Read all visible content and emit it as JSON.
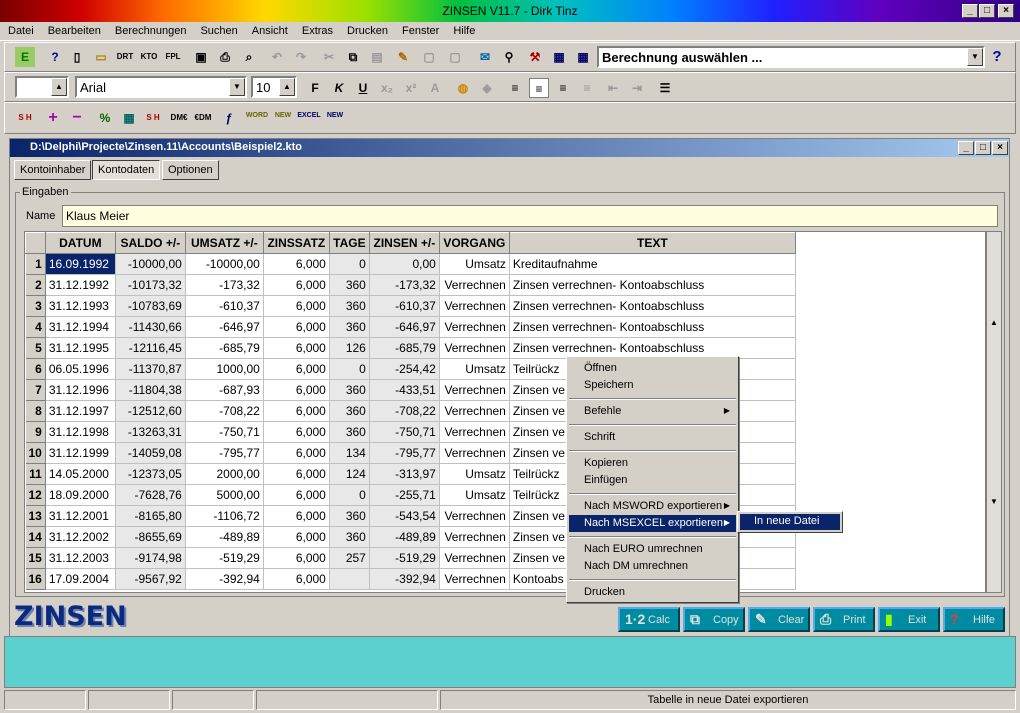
{
  "app": {
    "title": "ZINSEN V11.7 - Dirk Tinz"
  },
  "menu": [
    "Datei",
    "Bearbeiten",
    "Berechnungen",
    "Suchen",
    "Ansicht",
    "Extras",
    "Drucken",
    "Fenster",
    "Hilfe"
  ],
  "toolbar": {
    "calc_select": "Berechnung auswählen ...",
    "font_name": "Arial",
    "font_size": "10",
    "bold": "F",
    "italic": "K",
    "underline": "U",
    "help": "?"
  },
  "document": {
    "title": "D:\\Delphi\\Projecte\\Zinsen.11\\Accounts\\Beispiel2.kto",
    "tabs": [
      "Kontoinhaber",
      "Kontodaten",
      "Optionen"
    ],
    "group_label": "Eingaben",
    "name_label": "Name",
    "name_value": "Klaus Meier"
  },
  "table": {
    "headers": [
      "DATUM",
      "SALDO +/-",
      "UMSATZ +/-",
      "ZINSSATZ",
      "TAGE",
      "ZINSEN +/-",
      "VORGANG",
      "TEXT"
    ],
    "rows": [
      [
        "1",
        "16.09.1992",
        "-10000,00",
        "-10000,00",
        "6,000",
        "0",
        "0,00",
        "Umsatz",
        "Kreditaufnahme"
      ],
      [
        "2",
        "31.12.1992",
        "-10173,32",
        "-173,32",
        "6,000",
        "360",
        "-173,32",
        "Verrechnen",
        "Zinsen verrechnen- Kontoabschluss"
      ],
      [
        "3",
        "31.12.1993",
        "-10783,69",
        "-610,37",
        "6,000",
        "360",
        "-610,37",
        "Verrechnen",
        "Zinsen verrechnen- Kontoabschluss"
      ],
      [
        "4",
        "31.12.1994",
        "-11430,66",
        "-646,97",
        "6,000",
        "360",
        "-646,97",
        "Verrechnen",
        "Zinsen verrechnen- Kontoabschluss"
      ],
      [
        "5",
        "31.12.1995",
        "-12116,45",
        "-685,79",
        "6,000",
        "126",
        "-685,79",
        "Verrechnen",
        "Zinsen verrechnen- Kontoabschluss"
      ],
      [
        "6",
        "06.05.1996",
        "-11370,87",
        "1000,00",
        "6,000",
        "0",
        "-254,42",
        "Umsatz",
        "Teilrückz"
      ],
      [
        "7",
        "31.12.1996",
        "-11804,38",
        "-687,93",
        "6,000",
        "360",
        "-433,51",
        "Verrechnen",
        "Zinsen ve"
      ],
      [
        "8",
        "31.12.1997",
        "-12512,60",
        "-708,22",
        "6,000",
        "360",
        "-708,22",
        "Verrechnen",
        "Zinsen ve"
      ],
      [
        "9",
        "31.12.1998",
        "-13263,31",
        "-750,71",
        "6,000",
        "360",
        "-750,71",
        "Verrechnen",
        "Zinsen ve"
      ],
      [
        "10",
        "31.12.1999",
        "-14059,08",
        "-795,77",
        "6,000",
        "134",
        "-795,77",
        "Verrechnen",
        "Zinsen ve"
      ],
      [
        "11",
        "14.05.2000",
        "-12373,05",
        "2000,00",
        "6,000",
        "124",
        "-313,97",
        "Umsatz",
        "Teilrückz"
      ],
      [
        "12",
        "18.09.2000",
        "-7628,76",
        "5000,00",
        "6,000",
        "0",
        "-255,71",
        "Umsatz",
        "Teilrückz"
      ],
      [
        "13",
        "31.12.2001",
        "-8165,80",
        "-1106,72",
        "6,000",
        "360",
        "-543,54",
        "Verrechnen",
        "Zinsen ve"
      ],
      [
        "14",
        "31.12.2002",
        "-8655,69",
        "-489,89",
        "6,000",
        "360",
        "-489,89",
        "Verrechnen",
        "Zinsen ve"
      ],
      [
        "15",
        "31.12.2003",
        "-9174,98",
        "-519,29",
        "6,000",
        "257",
        "-519,29",
        "Verrechnen",
        "Zinsen ve"
      ],
      [
        "16",
        "17.09.2004",
        "-9567,92",
        "-392,94",
        "6,000",
        "",
        "-392,94",
        "Verrechnen",
        "Kontoabs                                            mitteln"
      ]
    ]
  },
  "context_menu": {
    "items": [
      "Öffnen",
      "Speichern",
      "Befehle",
      "Schrift",
      "Kopieren",
      "Einfügen",
      "Nach MSWORD exportieren",
      "Nach MSEXCEL exportieren",
      "Nach EURO umrechnen",
      "Nach DM umrechnen",
      "Drucken"
    ],
    "submenu": "In neue Datei"
  },
  "logo": "ZINSEN",
  "buttons": [
    "Calc",
    "Copy",
    "Clear",
    "Print",
    "Exit",
    "Hilfe"
  ],
  "status": {
    "text": "Tabelle in neue Datei exportieren"
  }
}
